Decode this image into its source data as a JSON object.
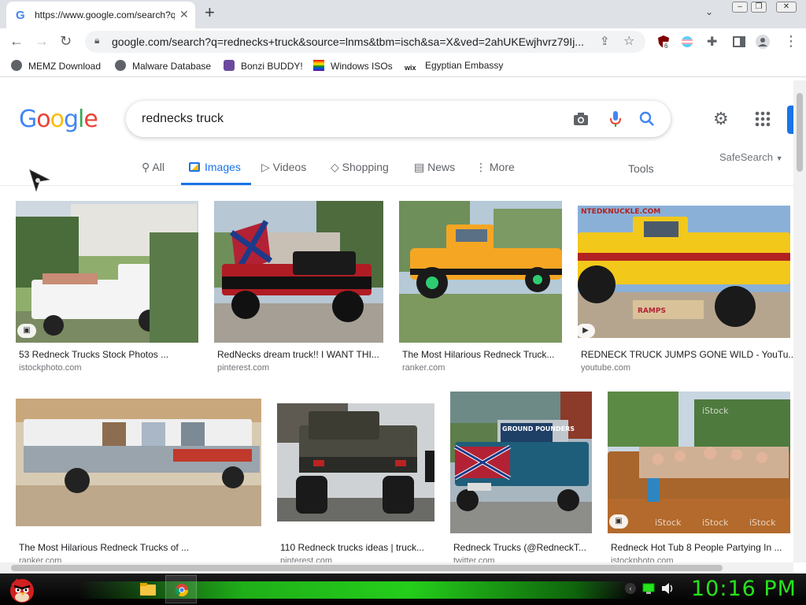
{
  "browser": {
    "tab_title": "https://www.google.com/search?q=rednecks+truck",
    "url": "google.com/search?q=rednecks+truck&source=lnms&tbm=isch&sa=X&ved=2ahUKEwjhvrz79Ij...",
    "extension_badge": "6"
  },
  "bookmarks": [
    "MEMZ Download",
    "Malware Database",
    "Bonzi BUDDY!",
    "Windows ISOs",
    "Egyptian Embassy"
  ],
  "google": {
    "query": "rednecks truck",
    "tabs": [
      "All",
      "Images",
      "Videos",
      "Shopping",
      "News",
      "More"
    ],
    "tools_label": "Tools",
    "safesearch_label": "SafeSearch"
  },
  "results": [
    {
      "title": "53 Redneck Trucks Stock Photos ...",
      "source": "istockphoto.com"
    },
    {
      "title": "RedNecks dream truck!! I WANT THI...",
      "source": "pinterest.com"
    },
    {
      "title": "The Most Hilarious Redneck Truck...",
      "source": "ranker.com"
    },
    {
      "title": "REDNECK TRUCK JUMPS GONE WILD - YouTu...",
      "source": "youtube.com"
    },
    {
      "title": "The Most Hilarious Redneck Trucks of ...",
      "source": "ranker.com"
    },
    {
      "title": "110 Redneck trucks ideas | truck...",
      "source": "pinterest.com"
    },
    {
      "title": "Redneck Trucks (@RedneckT...",
      "source": "twitter.com"
    },
    {
      "title": "Redneck Hot Tub 8 People Partying In ...",
      "source": "istockphoto.com"
    }
  ],
  "image_texts": {
    "ntedknuckle": "NTEDKNUCKLE.COM",
    "ground_pounders": "GROUND POUNDERS",
    "istock": "iStock"
  },
  "taskbar": {
    "clock": "10:16 PM"
  },
  "colors": {
    "google_blue": "#4285f4",
    "google_red": "#ea4335",
    "google_yellow": "#fbbc05",
    "google_green": "#34a853",
    "active_tab": "#1a73e8",
    "clock_green": "#27e31c"
  }
}
